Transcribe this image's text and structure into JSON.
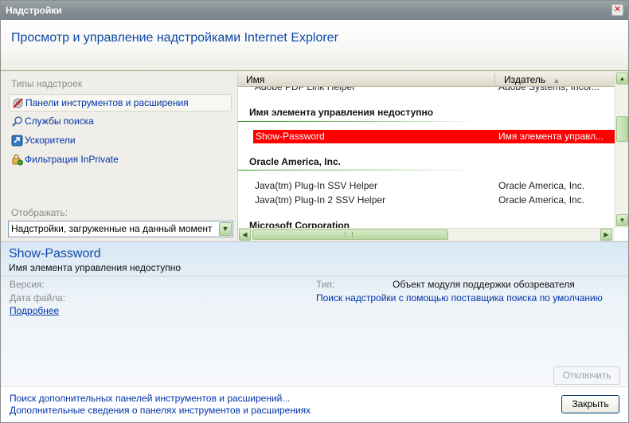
{
  "window": {
    "title": "Надстройки",
    "close_icon": "close-icon"
  },
  "header": {
    "heading": "Просмотр и управление надстройками Internet Explorer"
  },
  "left": {
    "types_label": "Типы надстроек",
    "types": [
      {
        "label": "Панели инструментов и расширения",
        "icon": "toolbar-gear-icon",
        "selected": true
      },
      {
        "label": "Службы поиска",
        "icon": "magnifier-icon",
        "selected": false
      },
      {
        "label": "Ускорители",
        "icon": "accelerator-icon",
        "selected": false
      },
      {
        "label": "Фильтрация InPrivate",
        "icon": "inprivate-icon",
        "selected": false
      }
    ],
    "show_label": "Отображать:",
    "show_value": "Надстройки, загруженные на данный момент"
  },
  "list": {
    "columns": {
      "name": "Имя",
      "publisher": "Издатель"
    },
    "partial_row": {
      "name": "Adobe PDF Link Helper",
      "publisher": "Adobe Systems, Incor..."
    },
    "groups": [
      {
        "title": "Имя элемента управления недоступно",
        "rows": [
          {
            "name": "Show-Password",
            "publisher": "Имя элемента управл...",
            "selected": true
          }
        ]
      },
      {
        "title": "Oracle America, Inc.",
        "rows": [
          {
            "name": "Java(tm) Plug-In SSV Helper",
            "publisher": "Oracle America, Inc."
          },
          {
            "name": "Java(tm) Plug-In 2 SSV Helper",
            "publisher": "Oracle America, Inc."
          }
        ]
      },
      {
        "title": "Microsoft Corporation",
        "rows": []
      }
    ]
  },
  "details": {
    "name": "Show-Password",
    "publisher": "Имя элемента управления недоступно",
    "version_label": "Версия:",
    "date_label": "Дата файла:",
    "more_link": "Подробнее",
    "type_label": "Тип:",
    "type_value": "Объект модуля поддержки обозревателя",
    "search_link": "Поиск надстройки с помощью поставщика поиска по умолчанию",
    "disable_button": "Отключить"
  },
  "footer": {
    "link1": "Поиск дополнительных панелей инструментов и расширений...",
    "link2": "Дополнительные сведения о панелях инструментов и расширениях",
    "close_button": "Закрыть"
  },
  "colors": {
    "accent": "#1048a8",
    "selection": "#ff0000",
    "link": "#0033aa",
    "group_line": "#2e9a1e"
  }
}
